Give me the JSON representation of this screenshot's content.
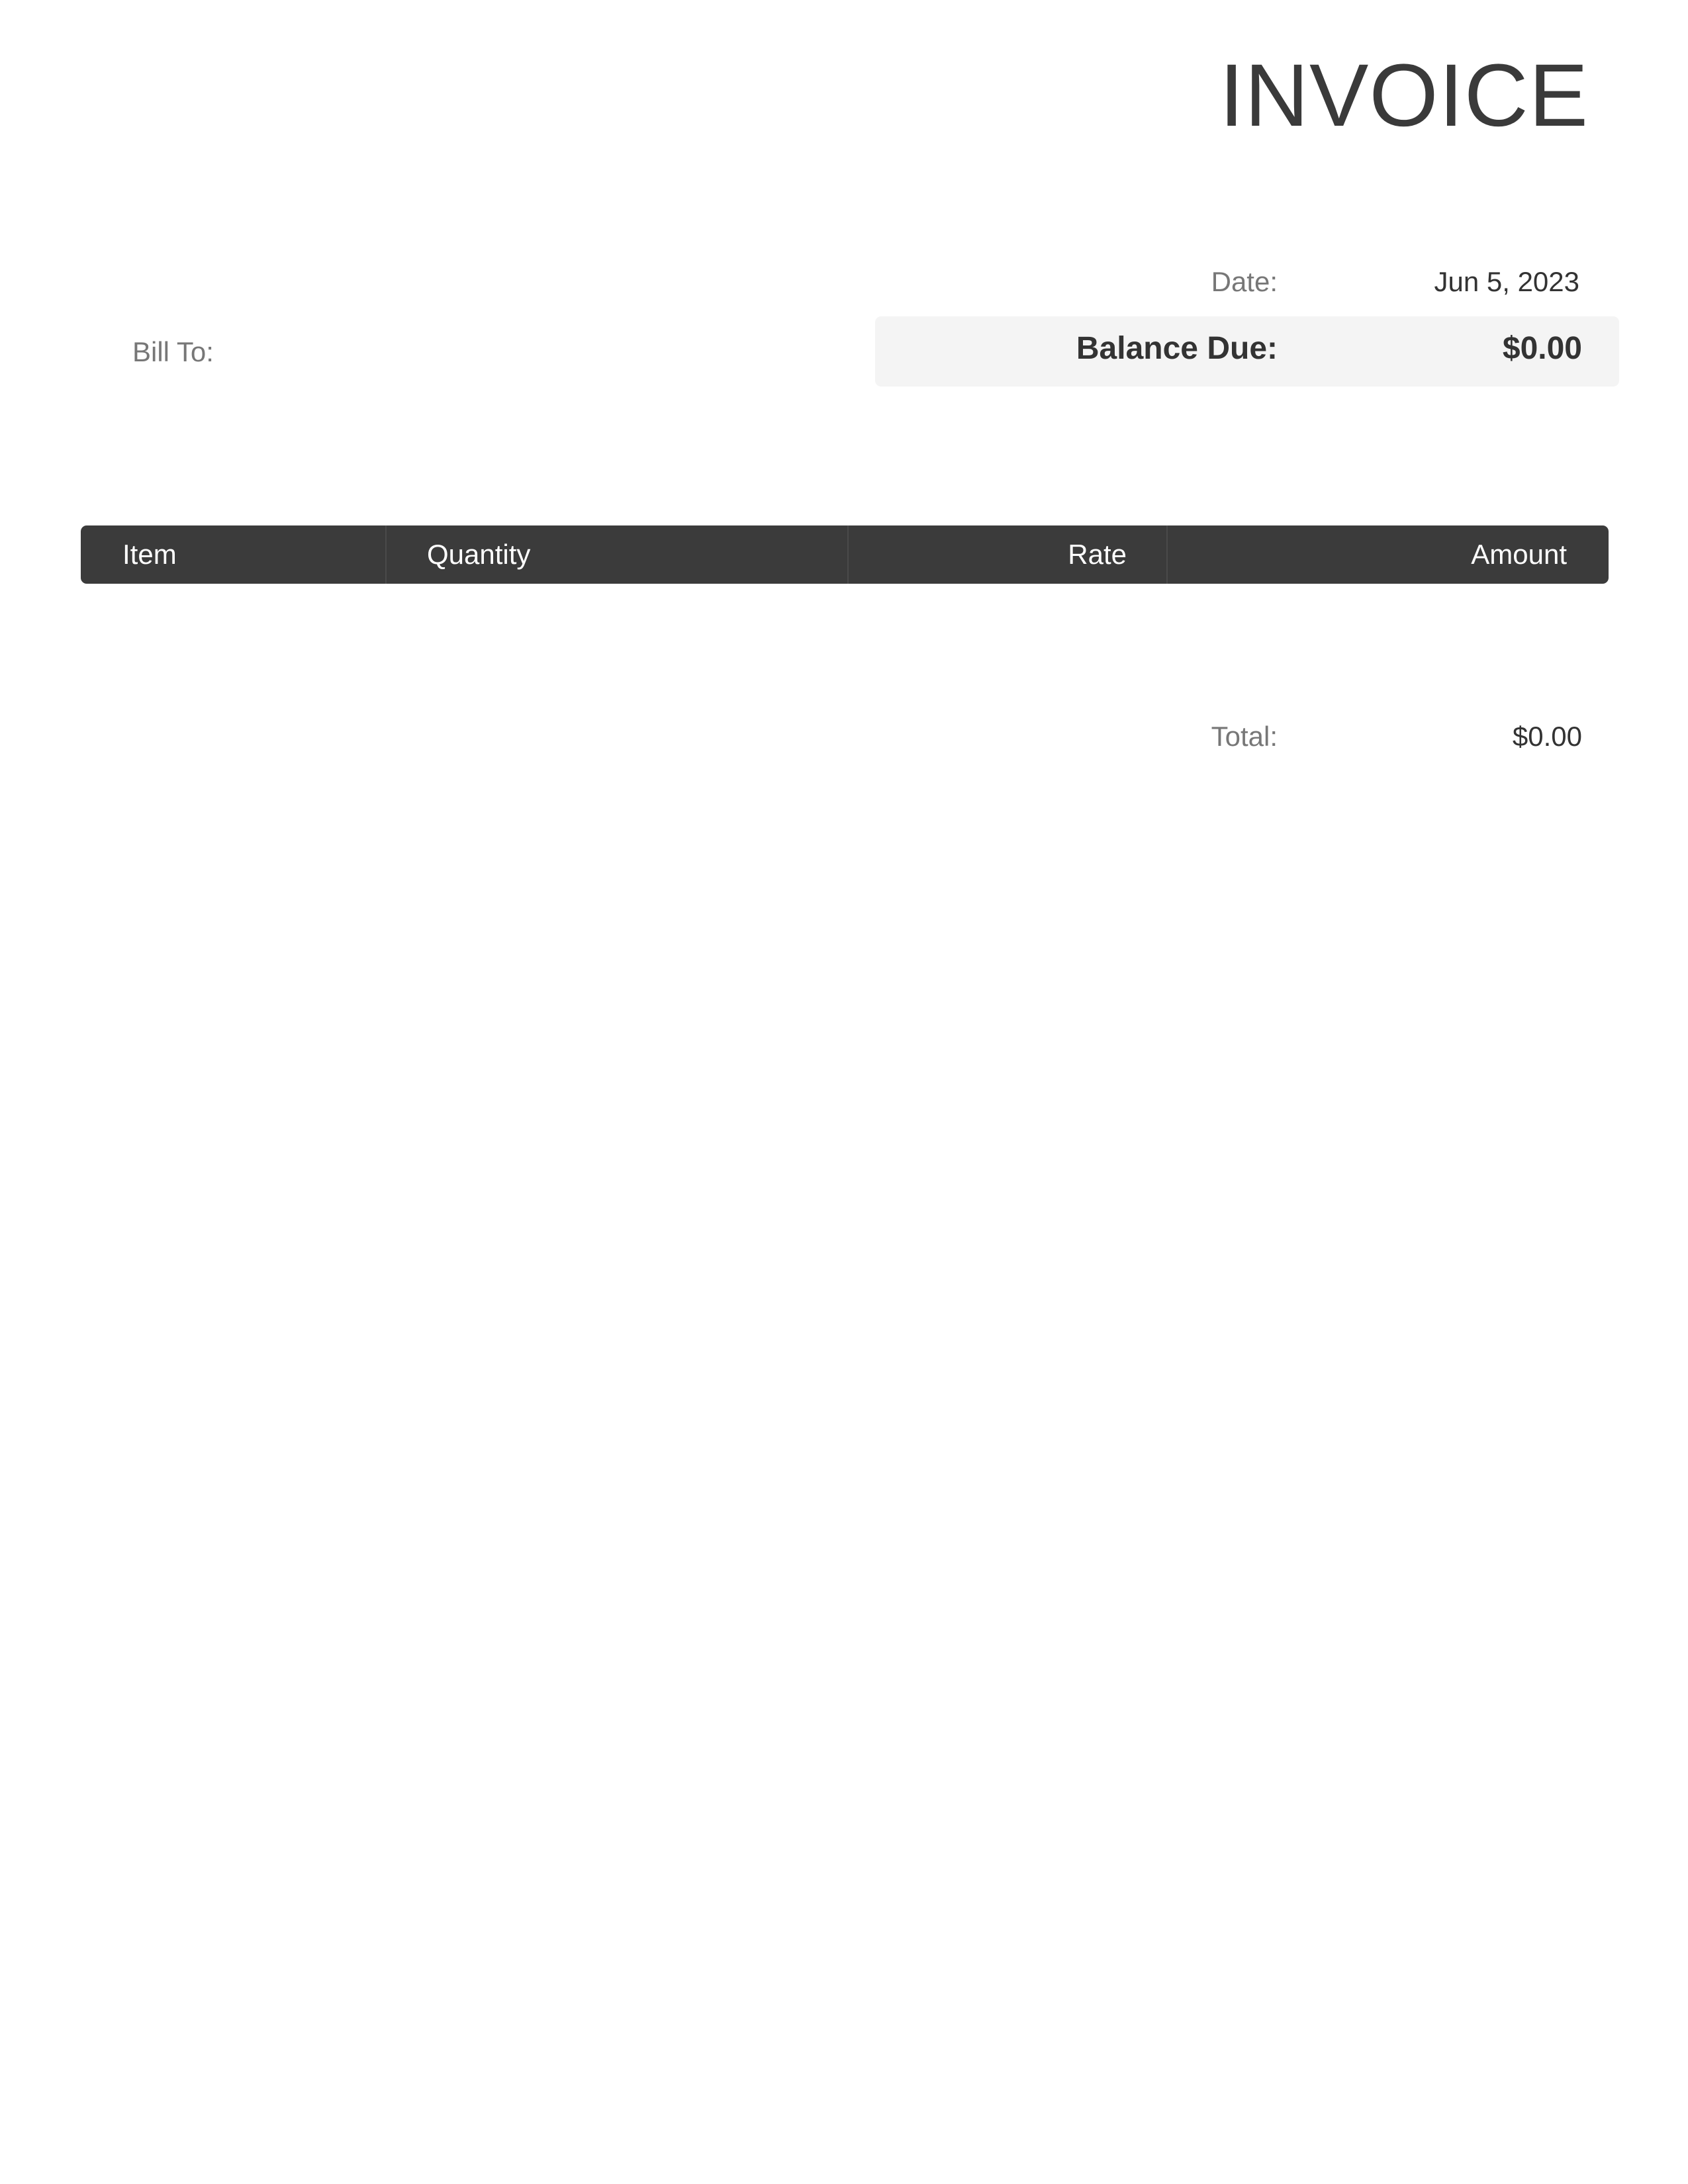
{
  "title": "INVOICE",
  "meta": {
    "date_label": "Date:",
    "date_value": "Jun 5, 2023",
    "balance_label": "Balance Due:",
    "balance_value": "$0.00"
  },
  "bill_to_label": "Bill To:",
  "table": {
    "columns": [
      "Item",
      "Quantity",
      "Rate",
      "Amount"
    ]
  },
  "totals": {
    "total_label": "Total:",
    "total_value": "$0.00"
  },
  "colors": {
    "header_bg": "#3b3b3b",
    "balance_bg": "#f4f4f4",
    "label_gray": "#777777",
    "text_dark": "#333333"
  }
}
